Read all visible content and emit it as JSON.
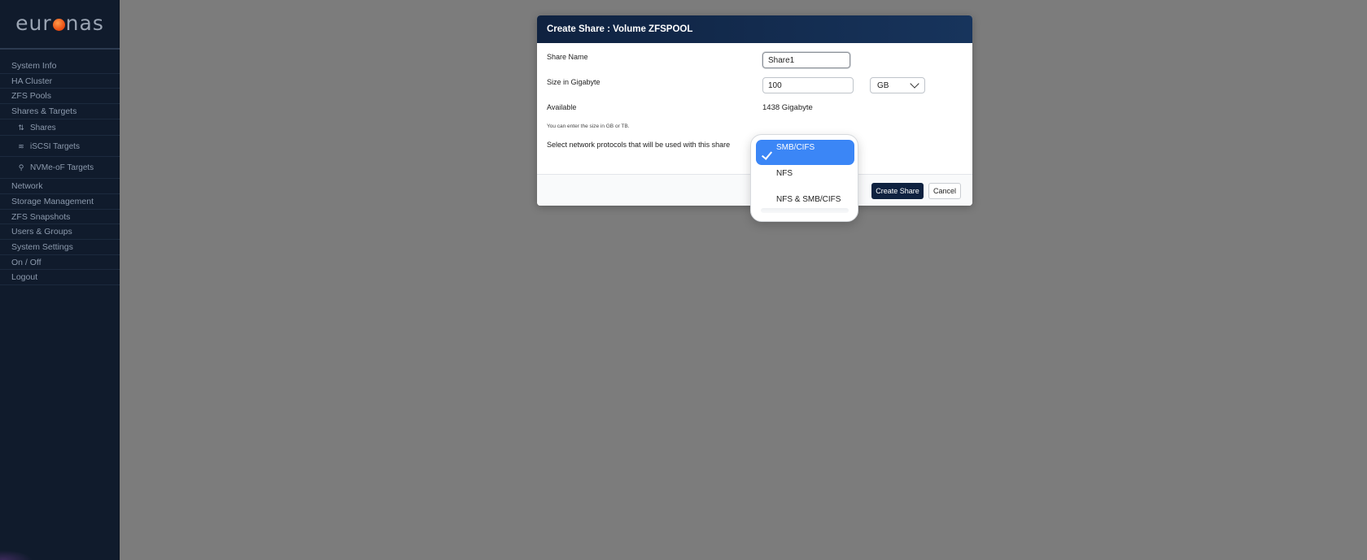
{
  "brand": {
    "logo_left": "eur",
    "logo_right": "nas"
  },
  "sidebar": {
    "items": [
      {
        "label": "System Info"
      },
      {
        "label": "HA Cluster"
      },
      {
        "label": "ZFS Pools"
      },
      {
        "label": "Shares & Targets"
      }
    ],
    "sub_items": [
      {
        "label": "Shares",
        "icon": "sliders-icon",
        "glyph": "⇅"
      },
      {
        "label": "iSCSI Targets",
        "icon": "server-icon",
        "glyph": "≋"
      },
      {
        "label": "NVMe-oF Targets",
        "icon": "microphone-icon",
        "glyph": "⚲"
      }
    ],
    "items_after": [
      {
        "label": "Network"
      },
      {
        "label": "Storage Management"
      },
      {
        "label": "ZFS Snapshots"
      },
      {
        "label": "Users & Groups"
      },
      {
        "label": "System Settings"
      },
      {
        "label": "On / Off"
      },
      {
        "label": "Logout"
      }
    ]
  },
  "modal": {
    "title": "Create Share : Volume ZFSPOOL",
    "share_name": {
      "label": "Share Name",
      "value": "Share1"
    },
    "size": {
      "label": "Size in Gigabyte",
      "value": "100",
      "unit": "GB"
    },
    "available": {
      "label": "Available",
      "value": "1438 Gigabyte"
    },
    "hint": "You can enter the size in GB or TB.",
    "protocols": {
      "label": "Select network protocols that will be used with this share"
    },
    "create_label": "Create Share",
    "cancel_label": "Cancel"
  },
  "dropdown": {
    "options": [
      {
        "label": "SMB/CIFS",
        "selected": true
      },
      {
        "label": "NFS",
        "selected": false
      },
      {
        "label": "NFS & SMB/CIFS",
        "selected": false
      }
    ]
  },
  "colors": {
    "sidebar_bg": "#101b2c",
    "overlay_bg": "#7c7c7c",
    "header_bg": "#0f2240",
    "selected_option": "#3b86f6",
    "logo_accent": "#e8490f"
  }
}
